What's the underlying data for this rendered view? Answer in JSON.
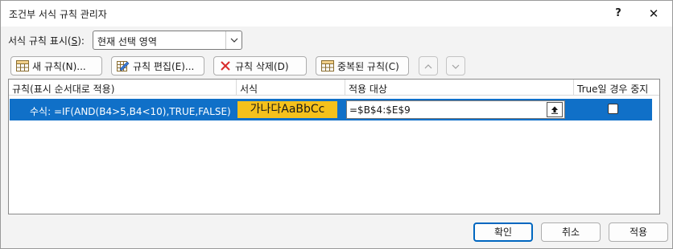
{
  "window": {
    "title": "조건부 서식 규칙 관리자",
    "help_label": "?",
    "close_label": "✕"
  },
  "show_rules": {
    "label_prefix": "서식 규칙 표시(",
    "label_mnemonic": "S",
    "label_suffix": "):",
    "selected_value": "현재 선택 영역"
  },
  "toolbar": {
    "new_rule": "새 규칙(N)...",
    "edit_rule": "규칙 편집(E)...",
    "delete_rule": "규칙 삭제(D)",
    "duplicate_rule": "중복된 규칙(C)"
  },
  "table": {
    "headers": [
      "규칙(표시 순서대로 적용)",
      "서식",
      "적용 대상",
      "True일 경우 중지"
    ],
    "rows": [
      {
        "rule": "수식: =IF(AND(B4>5,B4<10),TRUE,FALSE)",
        "format_preview": "가나다AaBbCc",
        "applies_to": "=$B$4:$E$9",
        "stop_if_true": false
      }
    ]
  },
  "footer": {
    "ok": "확인",
    "cancel": "취소",
    "apply": "적용"
  },
  "colors": {
    "selection": "#1070c8",
    "format_fill": "#f5c11b",
    "delete_icon": "#d92b2b"
  }
}
